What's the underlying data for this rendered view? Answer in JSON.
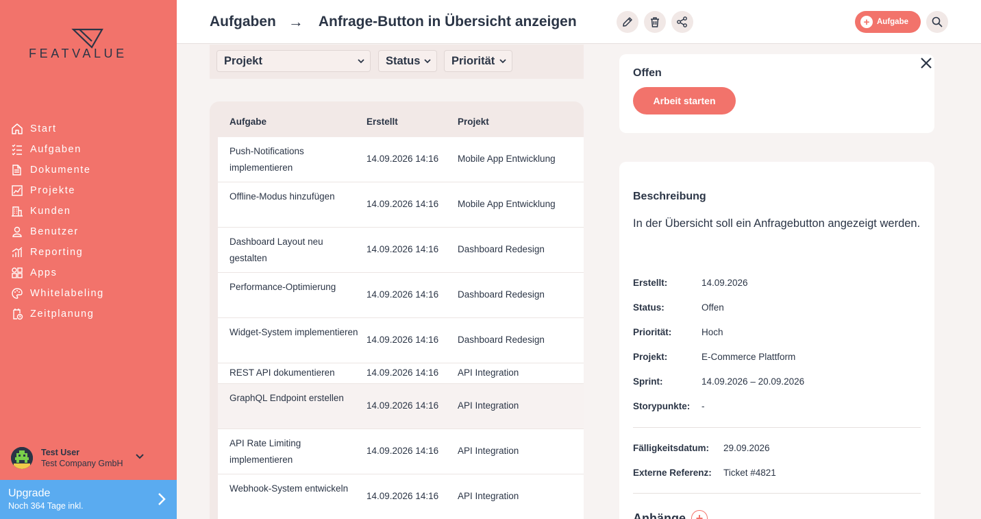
{
  "brand": {
    "name": "FEATVALUE",
    "accent": "#f2736b",
    "dark": "#2b3546",
    "upgrade_color": "#5aabf0"
  },
  "sidebar": {
    "items": [
      {
        "label": "Start",
        "icon": "home-icon"
      },
      {
        "label": "Aufgaben",
        "icon": "tasks-icon"
      },
      {
        "label": "Dokumente",
        "icon": "documents-icon"
      },
      {
        "label": "Projekte",
        "icon": "projects-icon"
      },
      {
        "label": "Kunden",
        "icon": "customers-icon"
      },
      {
        "label": "Benutzer",
        "icon": "user-icon"
      },
      {
        "label": "Reporting",
        "icon": "reporting-icon"
      },
      {
        "label": "Apps",
        "icon": "apps-icon"
      },
      {
        "label": "Whitelabeling",
        "icon": "palette-icon"
      },
      {
        "label": "Zeitplanung",
        "icon": "calendar-clock-icon"
      }
    ],
    "user": {
      "name": "Test User",
      "company": "Test Company GmbH"
    },
    "upgrade": {
      "title": "Upgrade",
      "subtitle": "Noch 364 Tage inkl."
    }
  },
  "header": {
    "section": "Aufgaben",
    "arrow": "→",
    "title": "Anfrage-Button in Übersicht anzeigen",
    "add_label": "Aufgabe"
  },
  "filters": {
    "project": "Projekt",
    "status": "Status",
    "priority": "Priorität"
  },
  "table": {
    "columns": [
      "Aufgabe",
      "Erstellt",
      "Projekt"
    ],
    "rows": [
      {
        "task": "Push-Notifications implementieren",
        "created": "14.09.2026 14:16",
        "project": "Mobile App Entwicklung"
      },
      {
        "task": "Offline-Modus hinzufügen",
        "created": "14.09.2026 14:16",
        "project": "Mobile App Entwicklung"
      },
      {
        "task": "Dashboard Layout neu gestalten",
        "created": "14.09.2026 14:16",
        "project": "Dashboard Redesign"
      },
      {
        "task": "Performance-Optimierung",
        "created": "14.09.2026 14:16",
        "project": "Dashboard Redesign"
      },
      {
        "task": "Widget-System implementieren",
        "created": "14.09.2026 14:16",
        "project": "Dashboard Redesign"
      },
      {
        "task": "REST API dokumentieren",
        "created": "14.09.2026 14:16",
        "project": "API Integration"
      },
      {
        "task": "GraphQL Endpoint erstellen",
        "created": "14.09.2026 14:16",
        "project": "API Integration"
      },
      {
        "task": "API Rate Limiting implementieren",
        "created": "14.09.2026 14:16",
        "project": "API Integration"
      },
      {
        "task": "Webhook-System entwickeln",
        "created": "14.09.2026 14:16",
        "project": "API Integration"
      }
    ]
  },
  "detail": {
    "status": "Offen",
    "start_label": "Arbeit starten",
    "description_title": "Beschreibung",
    "description": "In der Übersicht soll ein Anfragebutton angezeigt werden.",
    "meta": [
      {
        "key": "Erstellt:",
        "value": "14.09.2026"
      },
      {
        "key": "Status:",
        "value": "Offen"
      },
      {
        "key": "Priorität:",
        "value": "Hoch"
      },
      {
        "key": "Projekt:",
        "value": "E-Commerce Plattform"
      },
      {
        "key": "Sprint:",
        "value": "14.09.2026 – 20.09.2026"
      },
      {
        "key": "Storypunkte:",
        "value": "-"
      }
    ],
    "meta2": [
      {
        "key": "Fälligkeitsdatum:",
        "value": "29.09.2026"
      },
      {
        "key": "Externe Referenz:",
        "value": "Ticket #4821"
      }
    ],
    "attachments_title": "Anhänge"
  }
}
